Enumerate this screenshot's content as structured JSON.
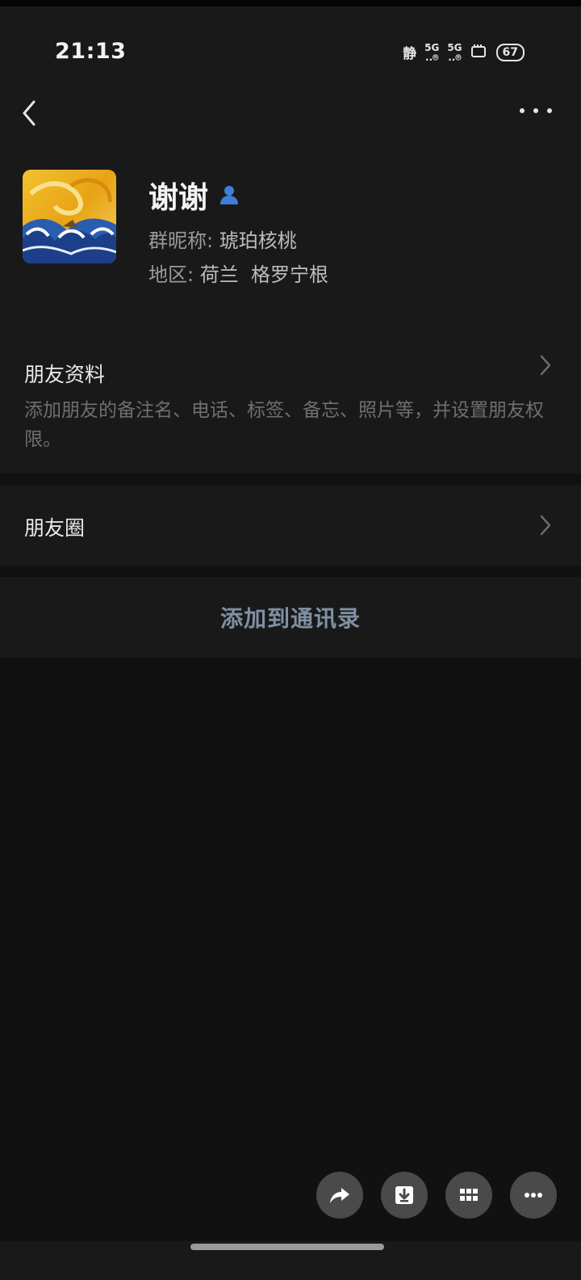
{
  "status_bar": {
    "time": "21:13",
    "mute_label": "静",
    "sim1_label": "5G",
    "sim2_label": "5G",
    "battery": "67",
    "icons": [
      "mute-icon",
      "signal-5g-icon",
      "signal-5g-icon",
      "notification-icon",
      "battery-icon"
    ]
  },
  "header": {
    "back_icon": "chevron-left-icon",
    "more_icon": "more-horizontal-icon"
  },
  "profile": {
    "name": "谢谢",
    "badge_icon": "person-icon",
    "badge_color": "#3d7ed8",
    "nickname_label": "群昵称:",
    "nickname_value": "琥珀核桃",
    "region_label": "地区:",
    "region_value": "荷兰  格罗宁根"
  },
  "friend_info": {
    "title": "朋友资料",
    "description": "添加朋友的备注名、电话、标签、备忘、照片等，并设置朋友权限。"
  },
  "moments": {
    "title": "朋友圈"
  },
  "add_contact": {
    "label": "添加到通讯录",
    "color": "#7f90a3"
  },
  "floating_actions": [
    {
      "icon": "share-icon"
    },
    {
      "icon": "download-icon"
    },
    {
      "icon": "apps-grid-icon"
    },
    {
      "icon": "more-icon"
    }
  ]
}
